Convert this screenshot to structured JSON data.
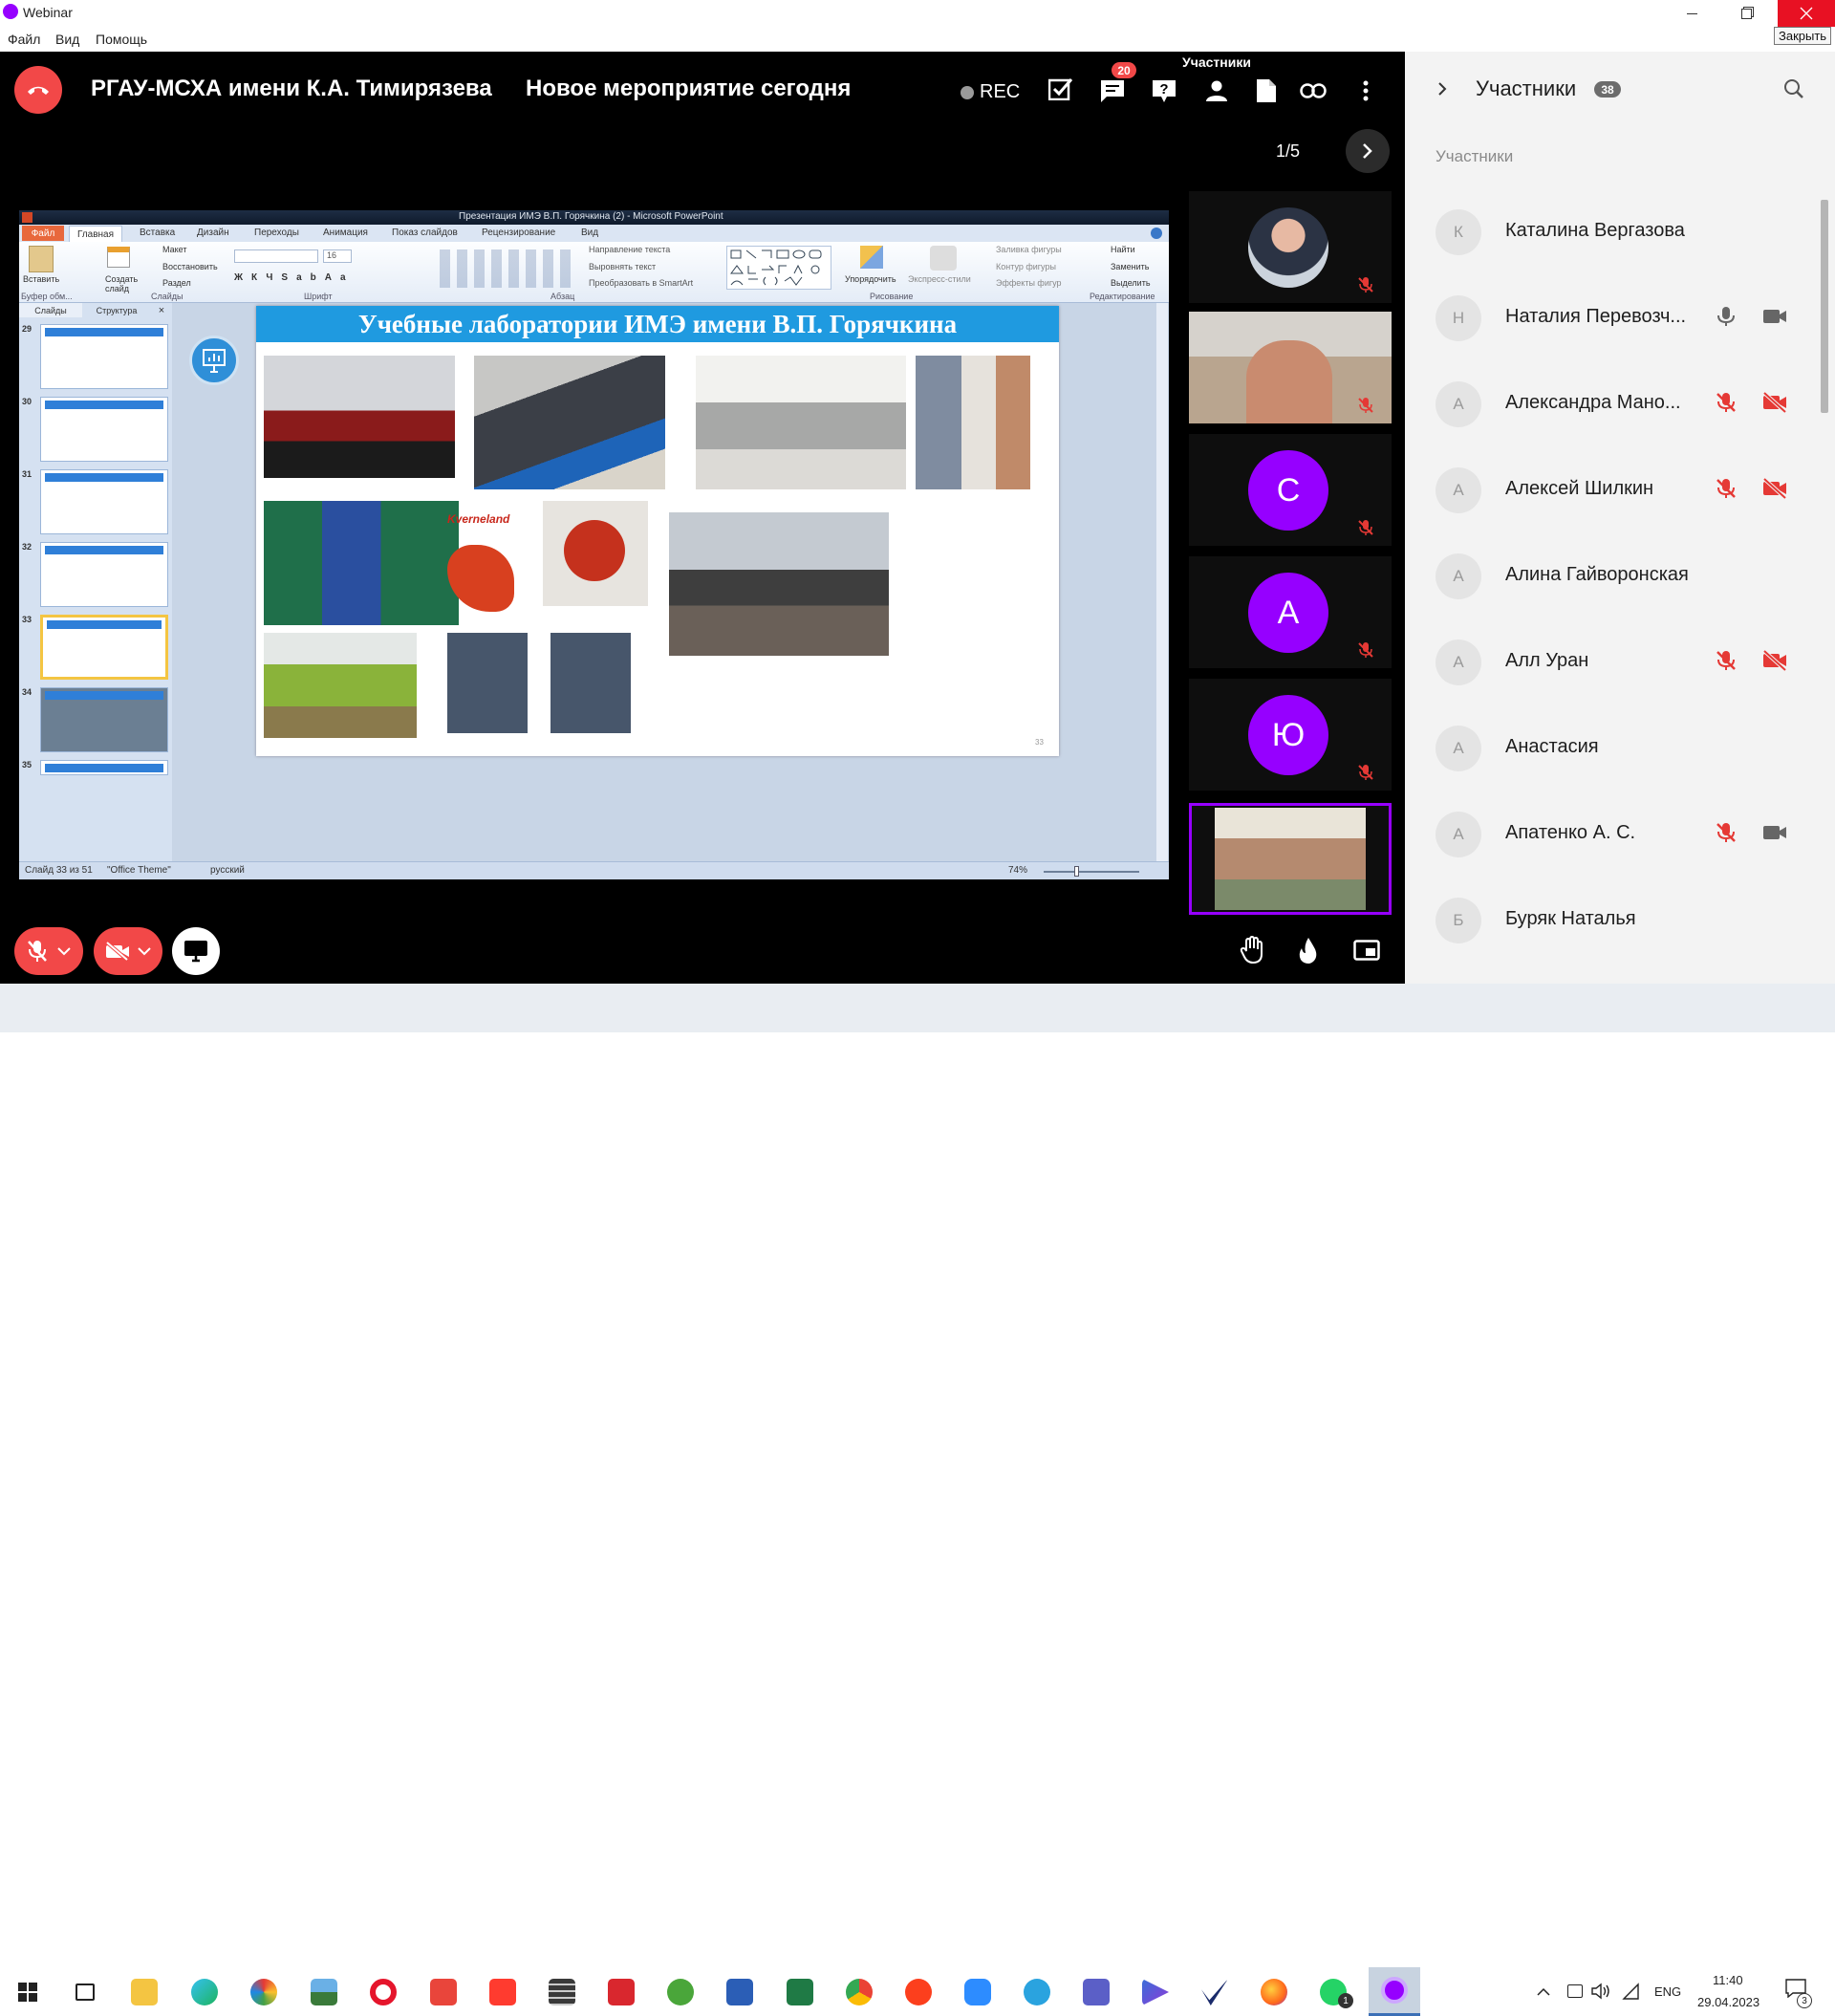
{
  "window": {
    "title": "Webinar",
    "close_tooltip": "Закрыть"
  },
  "menu": [
    "Файл",
    "Вид",
    "Помощь"
  ],
  "header": {
    "org": "РГАУ-МСХА имени К.А. Тимирязева",
    "event": "Новое мероприятие сегодня",
    "rec_label": "REC",
    "chat_badge": "20",
    "tooltip": "Участники",
    "page_indicator": "1/5"
  },
  "ppt": {
    "title": "Презентация ИМЭ В.П. Горячкина (2) - Microsoft PowerPoint",
    "tabs": [
      "Файл",
      "Главная",
      "Вставка",
      "Дизайн",
      "Переходы",
      "Анимация",
      "Показ слайдов",
      "Рецензирование",
      "Вид"
    ],
    "groups": [
      "Буфер обм...",
      "Слайды",
      "Шрифт",
      "Абзац",
      "Рисование",
      "Редактирование"
    ],
    "ribbon_btns": [
      "Вставить",
      "Создать слайд",
      "Макет",
      "Восстановить",
      "Раздел",
      "Направление текста",
      "Выровнять текст",
      "Преобразовать в SmartArt",
      "Упорядочить",
      "Экспресс-стили",
      "Заливка фигуры",
      "Контур фигуры",
      "Эффекты фигур",
      "Найти",
      "Заменить",
      "Выделить"
    ],
    "font_size": "16",
    "pane_tabs": [
      "Слайды",
      "Структура"
    ],
    "slide_numbers": [
      "29",
      "30",
      "31",
      "32",
      "33",
      "34",
      "35"
    ],
    "slide_title": "Учебные лаборатории ИМЭ имени В.П. Горячкина",
    "logo_text": "Kverneland",
    "slide_page_number": "33",
    "status": [
      "Слайд 33 из 51",
      "\"Office Theme\"",
      "русский"
    ],
    "zoom": "74%"
  },
  "participants_panel": {
    "title": "Участники",
    "count": "38",
    "section": "Участники",
    "list": [
      {
        "initial": "К",
        "name": "Каталина Вергазова",
        "mic": "none",
        "cam": "none"
      },
      {
        "initial": "Н",
        "name": "Наталия Перевозч...",
        "mic": "on",
        "cam": "on"
      },
      {
        "initial": "А",
        "name": "Александра Мано...",
        "mic": "off",
        "cam": "off"
      },
      {
        "initial": "А",
        "name": "Алексей Шилкин",
        "mic": "off",
        "cam": "off"
      },
      {
        "initial": "А",
        "name": "Алина Гайворонская",
        "mic": "none",
        "cam": "none"
      },
      {
        "initial": "А",
        "name": "Алл Уран",
        "mic": "off",
        "cam": "off"
      },
      {
        "initial": "А",
        "name": "Анастасия",
        "mic": "none",
        "cam": "none"
      },
      {
        "initial": "А",
        "name": "Апатенко А. С.",
        "mic": "off",
        "cam": "on"
      },
      {
        "initial": "Б",
        "name": "Буряк Наталья",
        "mic": "none",
        "cam": "none"
      }
    ]
  },
  "video_tiles": [
    "С",
    "А",
    "Ю"
  ],
  "taskbar": {
    "lang": "ENG",
    "time": "11:40",
    "date": "29.04.2023",
    "notif_count": "3",
    "whatsapp_badge": "1"
  },
  "colors": {
    "accent": "#9600ff",
    "end_call": "#f24848",
    "muted": "#e53935",
    "app_bg": "#000000",
    "ppt_blue": "#2f7fd8"
  }
}
